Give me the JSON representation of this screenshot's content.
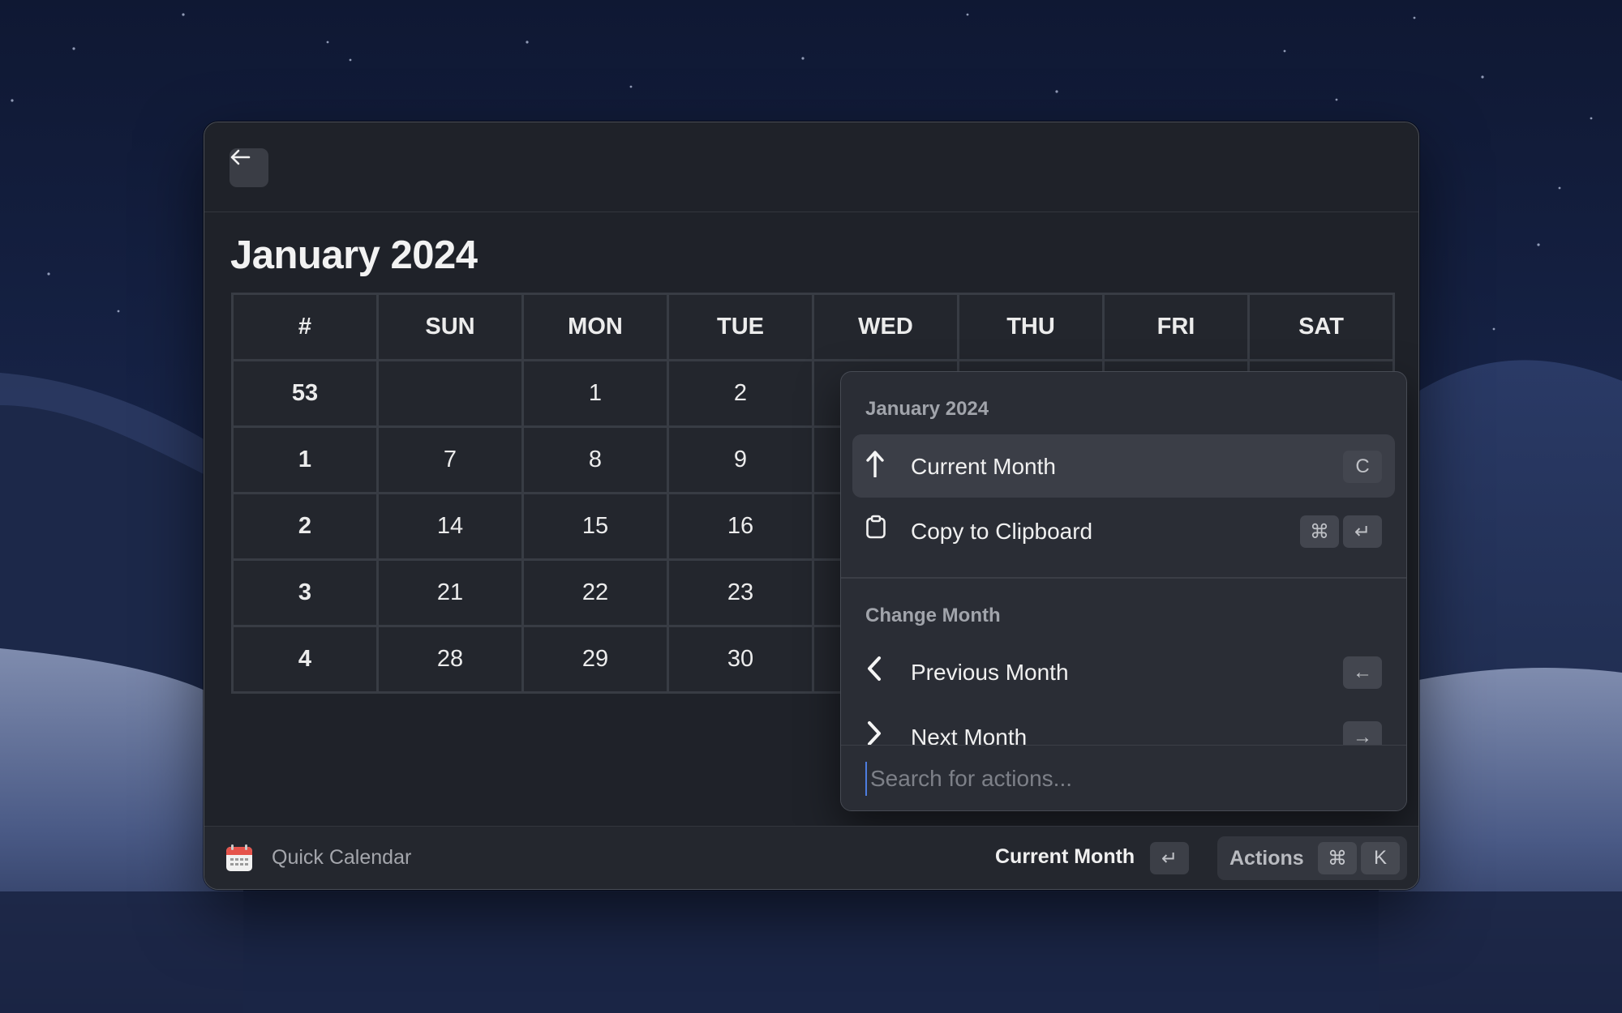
{
  "header": {
    "back_icon": "arrow-left-icon"
  },
  "calendar": {
    "title": "January 2024",
    "columns": [
      "#",
      "SUN",
      "MON",
      "TUE",
      "WED",
      "THU",
      "FRI",
      "SAT"
    ],
    "rows": [
      [
        "53",
        "",
        "1",
        "2",
        "",
        "",
        "",
        ""
      ],
      [
        "1",
        "7",
        "8",
        "9",
        "",
        "",
        "",
        ""
      ],
      [
        "2",
        "14",
        "15",
        "16",
        "",
        "",
        "",
        ""
      ],
      [
        "3",
        "21",
        "22",
        "23",
        "",
        "",
        "",
        ""
      ],
      [
        "4",
        "28",
        "29",
        "30",
        "",
        "",
        "",
        ""
      ]
    ]
  },
  "actions_panel": {
    "section1_label": "January 2024",
    "current_month": {
      "label": "Current Month",
      "icon": "arrow-up-icon",
      "shortcut": "C"
    },
    "copy": {
      "label": "Copy to Clipboard",
      "icon": "clipboard-icon",
      "shortcut_mod": "⌘",
      "shortcut_key": "↵"
    },
    "section2_label": "Change Month",
    "previous": {
      "label": "Previous Month",
      "icon": "chevron-left-icon",
      "shortcut": "←"
    },
    "next": {
      "label": "Next Month",
      "icon": "chevron-right-icon",
      "shortcut": "→"
    },
    "search_placeholder": "Search for actions..."
  },
  "footer": {
    "app_name": "Quick Calendar",
    "app_icon": "calendar-icon",
    "primary_action": "Current Month",
    "primary_key": "↵",
    "actions_label": "Actions",
    "actions_mod": "⌘",
    "actions_key": "K"
  },
  "colors": {
    "window_bg": "#1f2229",
    "panel_bg": "#2a2d35",
    "selected_bg": "#3b3e47",
    "calendar_icon_red": "#e5534b"
  }
}
